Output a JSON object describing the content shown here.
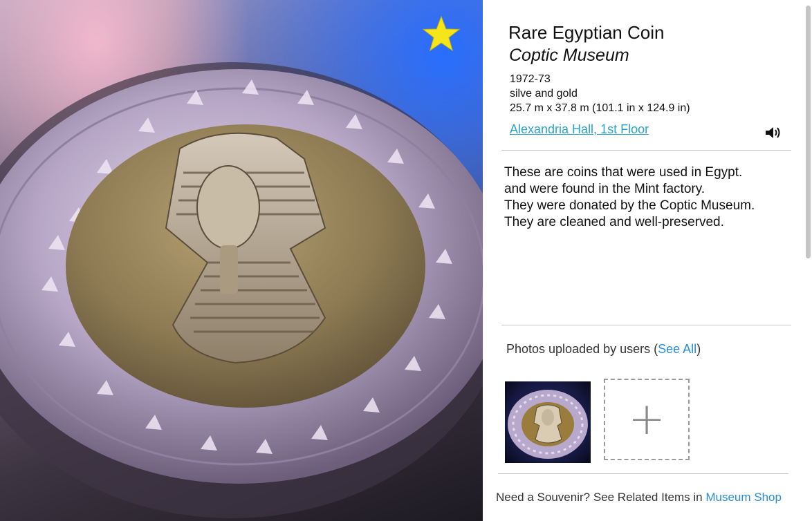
{
  "artifact": {
    "title": "Rare Egyptian Coin",
    "museum": "Coptic Museum",
    "date": "1972-73",
    "material": "silve and gold",
    "dimensions": "25.7 m x 37.8 m (101.1 in x 124.9 in)",
    "location": "Alexandria Hall, 1st Floor"
  },
  "description": [
    "These are coins that were used in Egypt.",
    "and were found in the Mint factory.",
    "They were donated by the Coptic Museum.",
    "They are cleaned and well-preserved."
  ],
  "user_photos": {
    "heading": "Photos uploaded by users (",
    "see_all": "See All",
    "heading_close": ")",
    "add_label": "+"
  },
  "souvenir": {
    "text": "Need a Souvenir? See Related Items in ",
    "link": "Museum Shop"
  },
  "icons": {
    "favorite": "star-icon",
    "audio": "speaker-icon",
    "add": "plus-icon"
  },
  "colors": {
    "link": "#29a3cc",
    "link_secondary": "#2a8ed8",
    "star": "#f5e61a",
    "divider": "#c8c8c8"
  }
}
